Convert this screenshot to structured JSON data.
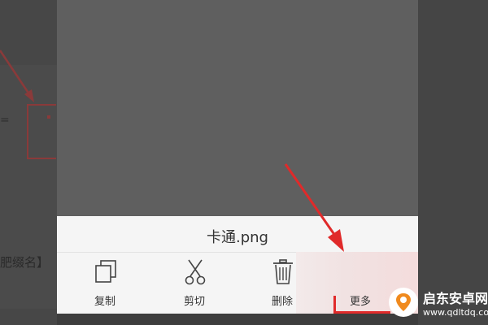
{
  "background": {
    "fragment_top": "=",
    "fragment_bottom": "肥缀名】"
  },
  "file": {
    "name": "卡通.png"
  },
  "actions": [
    {
      "id": "copy",
      "label": "复制",
      "icon": "copy-icon"
    },
    {
      "id": "cut",
      "label": "剪切",
      "icon": "scissors-icon"
    },
    {
      "id": "delete",
      "label": "删除",
      "icon": "trash-icon"
    },
    {
      "id": "more",
      "label": "更多",
      "icon": ""
    }
  ],
  "watermark": {
    "title": "启东安卓网",
    "url": "www.qdltdq.com"
  },
  "colors": {
    "highlight": "#e02a2a",
    "panel": "#f5f5f5",
    "overlay": "#5f5f5f"
  }
}
